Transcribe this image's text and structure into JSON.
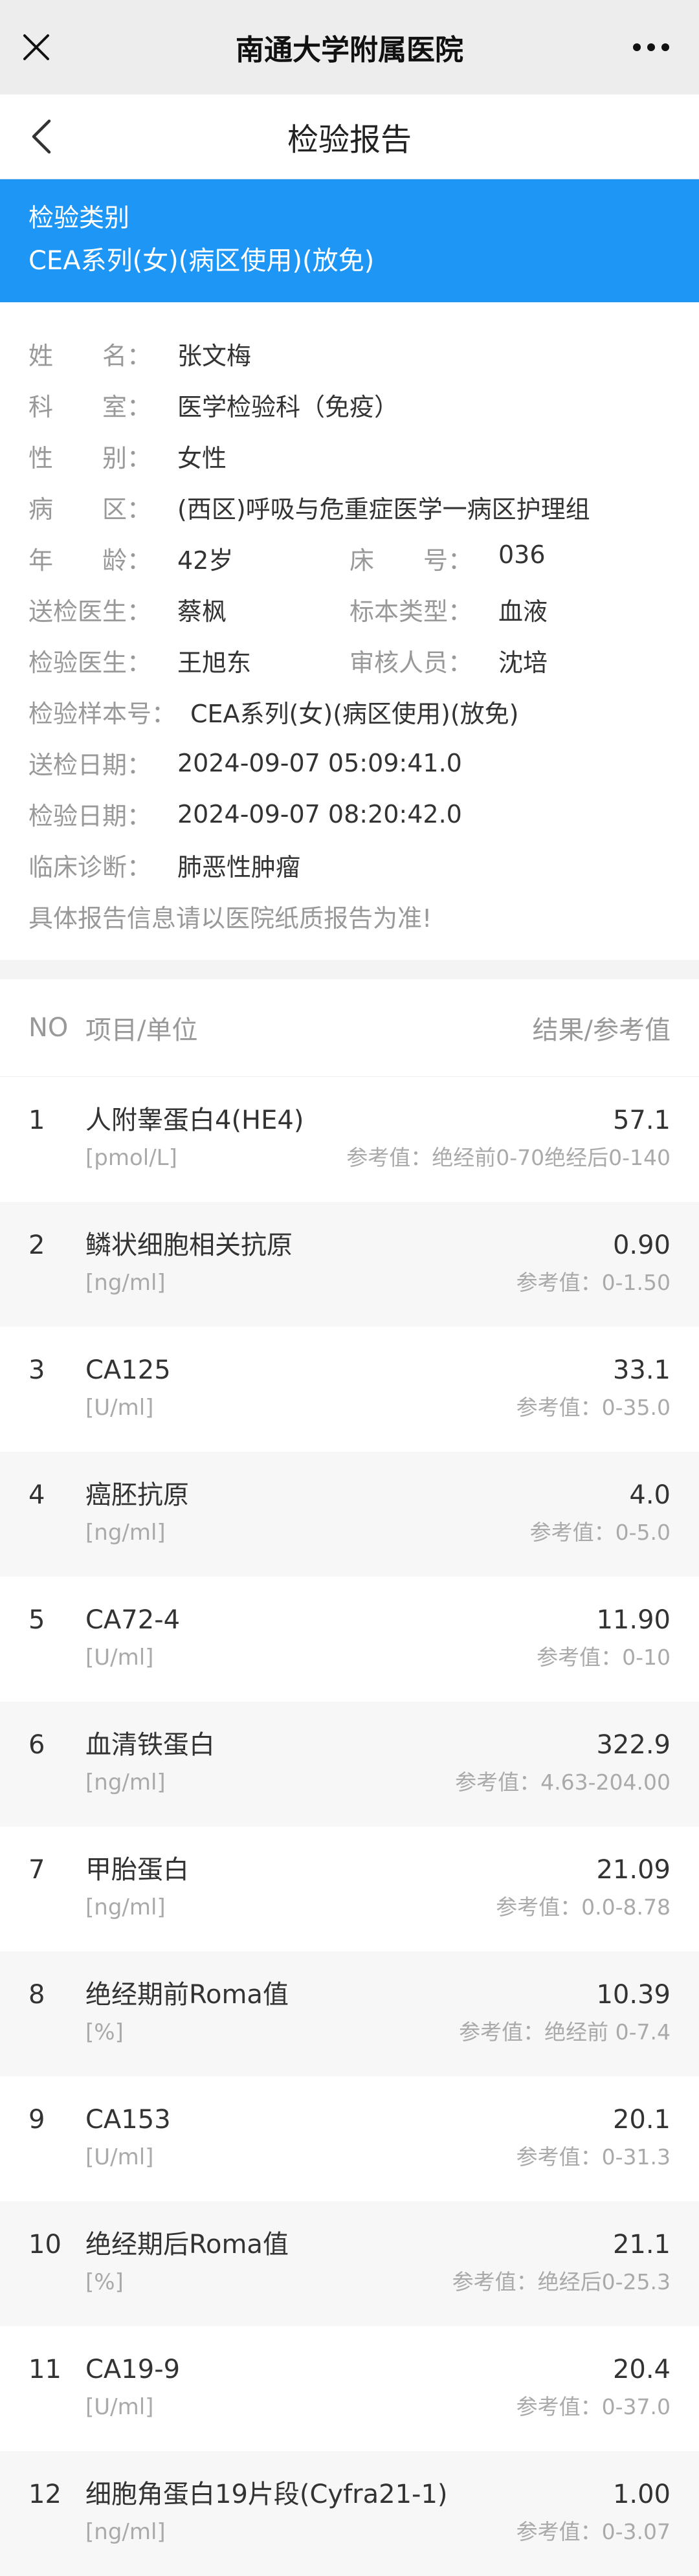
{
  "topbar": {
    "title": "南通大学附属医院"
  },
  "navbar": {
    "title": "检验报告"
  },
  "category": {
    "label": "检验类别",
    "value": "CEA系列(女)(病区使用)(放免)"
  },
  "info": {
    "name_key": [
      "姓",
      "名："
    ],
    "name": "张文梅",
    "dept_key": [
      "科",
      "室："
    ],
    "dept": "医学检验科（免疫）",
    "sex_key": [
      "性",
      "别："
    ],
    "sex": "女性",
    "ward_key": [
      "病",
      "区："
    ],
    "ward": "(西区)呼吸与危重症医学一病区护理组",
    "age_key": [
      "年",
      "龄："
    ],
    "age": "42岁",
    "bed_key": [
      "床",
      "号："
    ],
    "bed": "036",
    "doctor_key": "送检医生：",
    "doctor": "蔡枫",
    "sample_type_key": "标本类型：",
    "sample_type": "血液",
    "tester_key": "检验医生：",
    "tester": "王旭东",
    "reviewer_key": "审核人员：",
    "reviewer": "沈培",
    "sample_no_key": "检验样本号：",
    "sample_no": "CEA系列(女)(病区使用)(放免)",
    "send_date_key": "送检日期：",
    "send_date": "2024-09-07 05:09:41.0",
    "test_date_key": "检验日期：",
    "test_date": "2024-09-07 08:20:42.0",
    "diagnosis_key": "临床诊断：",
    "diagnosis": "肺恶性肿瘤",
    "note": "具体报告信息请以医院纸质报告为准!"
  },
  "table": {
    "headers": {
      "no": "NO",
      "item": "项目/单位",
      "result": "结果/参考值"
    },
    "rows": [
      {
        "no": "1",
        "name": "人附睾蛋白4(HE4)",
        "unit": "[pmol/L]",
        "result": "57.1",
        "ref": "参考值：绝经前0-70绝经后0-140"
      },
      {
        "no": "2",
        "name": "鳞状细胞相关抗原",
        "unit": "[ng/ml]",
        "result": "0.90",
        "ref": "参考值：0-1.50"
      },
      {
        "no": "3",
        "name": "CA125",
        "unit": "[U/ml]",
        "result": "33.1",
        "ref": "参考值：0-35.0"
      },
      {
        "no": "4",
        "name": "癌胚抗原",
        "unit": "[ng/ml]",
        "result": "4.0",
        "ref": "参考值：0-5.0"
      },
      {
        "no": "5",
        "name": "CA72-4",
        "unit": "[U/ml]",
        "result": "11.90",
        "ref": "参考值：0-10"
      },
      {
        "no": "6",
        "name": "血清铁蛋白",
        "unit": "[ng/ml]",
        "result": "322.9",
        "ref": "参考值：4.63-204.00"
      },
      {
        "no": "7",
        "name": "甲胎蛋白",
        "unit": "[ng/ml]",
        "result": "21.09",
        "ref": "参考值：0.0-8.78"
      },
      {
        "no": "8",
        "name": "绝经期前Roma值",
        "unit": "[%]",
        "result": "10.39",
        "ref": "参考值：绝经前 0-7.4"
      },
      {
        "no": "9",
        "name": "CA153",
        "unit": "[U/ml]",
        "result": "20.1",
        "ref": "参考值：0-31.3"
      },
      {
        "no": "10",
        "name": "绝经期后Roma值",
        "unit": "[%]",
        "result": "21.1",
        "ref": "参考值：绝经后0-25.3"
      },
      {
        "no": "11",
        "name": "CA19-9",
        "unit": "[U/ml]",
        "result": "20.4",
        "ref": "参考值：0-37.0"
      },
      {
        "no": "12",
        "name": "细胞角蛋白19片段(Cyfra21-1)",
        "unit": "[ng/ml]",
        "result": "1.00",
        "ref": "参考值：0-3.07"
      }
    ]
  }
}
